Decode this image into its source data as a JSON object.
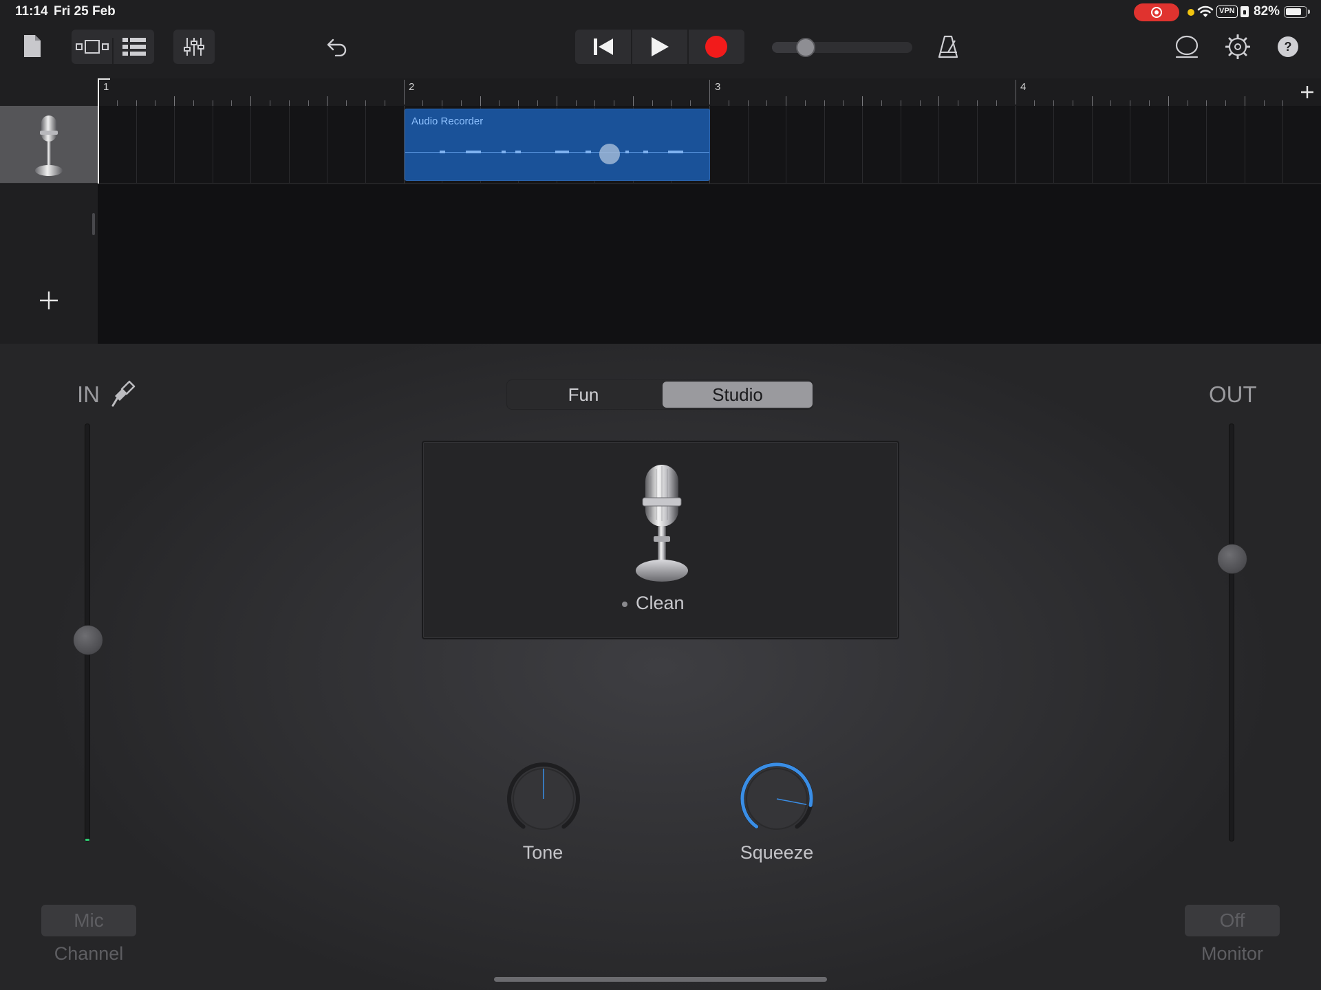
{
  "status_bar": {
    "time": "11:14",
    "date": "Fri 25 Feb",
    "vpn": "VPN",
    "battery_percent": "82%",
    "battery_level": 0.82,
    "record_indicator_color": "#e0332f"
  },
  "toolbar": {
    "icons": [
      "document-icon",
      "track-view-icon",
      "tracks-list-icon",
      "mixer-icon",
      "undo-icon",
      "go-to-start-icon",
      "play-icon",
      "record-icon",
      "metronome-icon",
      "loop-browser-icon",
      "settings-icon",
      "help-icon"
    ],
    "master_volume_level": 0.2,
    "record_color": "#f21b1b"
  },
  "ruler": {
    "bars": [
      "1",
      "2",
      "3",
      "4"
    ]
  },
  "tracks": [
    {
      "instrument_icon": "microphone-icon",
      "region": {
        "label": "Audio Recorder",
        "color": "#1a5299"
      }
    }
  ],
  "panel": {
    "in_label": "IN",
    "out_label": "OUT",
    "mode_tabs": [
      {
        "label": "Fun",
        "active": false
      },
      {
        "label": "Studio",
        "active": true
      }
    ],
    "preset_name": "Clean",
    "knobs": [
      {
        "label": "Tone",
        "value": 0.5
      },
      {
        "label": "Squeeze",
        "value": 0.85,
        "accent": "#3a8ee6"
      }
    ],
    "input_level": 0.48,
    "output_level": 0.69,
    "channel_button": "Mic",
    "channel_caption": "Channel",
    "monitor_button": "Off",
    "monitor_caption": "Monitor"
  }
}
